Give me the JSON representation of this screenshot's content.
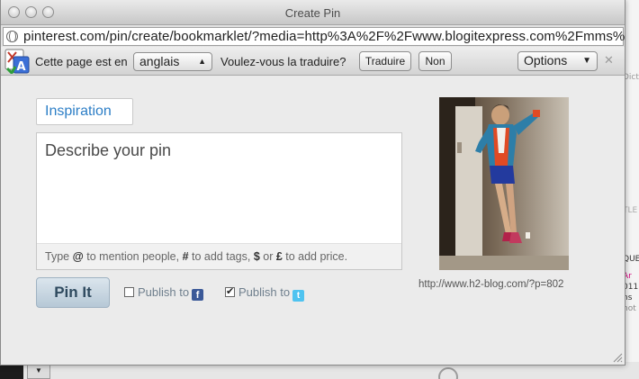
{
  "window": {
    "title": "Create Pin"
  },
  "address_bar": {
    "url": "pinterest.com/pin/create/bookmarklet/?media=http%3A%2F%2Fwww.blogitexpress.com%2Fmms%2Fd..."
  },
  "translate_bar": {
    "prefix": "Cette page est en",
    "language": "anglais",
    "question": "Voulez-vous la traduire?",
    "translate_button": "Traduire",
    "no_button": "Non",
    "options_button": "Options"
  },
  "pin_form": {
    "board": "Inspiration",
    "description_placeholder": "Describe your pin",
    "hint_parts": [
      "Type ",
      "@",
      " to mention people, ",
      "#",
      " to add tags, ",
      "$",
      " or ",
      "£",
      " to add price."
    ],
    "pin_button": "Pin It",
    "publish_facebook": {
      "label": "Publish to",
      "checked": false
    },
    "publish_twitter": {
      "label": "Publish to",
      "checked": true
    }
  },
  "image": {
    "source_url": "http://www.h2-blog.com/?p=802"
  },
  "background_page": {
    "right_texts": [
      "Dict",
      "TLE",
      "QUE",
      "Ar",
      "011",
      "ns",
      "hot"
    ]
  },
  "colors": {
    "link_blue": "#2c7ec6",
    "facebook": "#3b5998",
    "twitter": "#4fc3f0",
    "background_pink": "#d6007e"
  }
}
